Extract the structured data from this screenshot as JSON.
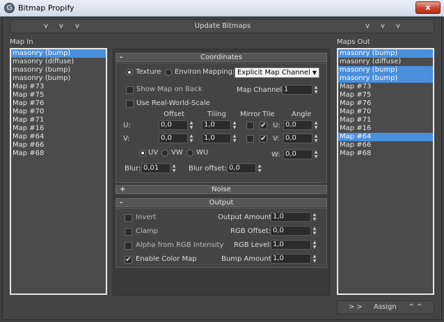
{
  "window": {
    "title": "Bitmap Propify",
    "close_glyph": "x",
    "app_icon": "G"
  },
  "topbar": {
    "chevrons": [
      "v",
      "v",
      "v",
      "v",
      "v",
      "v"
    ],
    "update_label": "Update Bitmaps"
  },
  "map_in": {
    "label": "Map In",
    "items": [
      {
        "text": "masonry (bump)",
        "selected": true
      },
      {
        "text": "masonry (diffuse)",
        "selected": false
      },
      {
        "text": "masonry (bump)",
        "selected": false
      },
      {
        "text": "masonry (bump)",
        "selected": false
      },
      {
        "text": "Map #73",
        "selected": false
      },
      {
        "text": "Map #75",
        "selected": false
      },
      {
        "text": "Map #76",
        "selected": false
      },
      {
        "text": "Map #70",
        "selected": false
      },
      {
        "text": "Map #71",
        "selected": false
      },
      {
        "text": "Map #16",
        "selected": false
      },
      {
        "text": "Map #64",
        "selected": false
      },
      {
        "text": "Map #66",
        "selected": false
      },
      {
        "text": "Map #68",
        "selected": false
      }
    ]
  },
  "map_out": {
    "label": "Maps Out",
    "items": [
      {
        "text": "masonry (bump)",
        "selected": true
      },
      {
        "text": "masonry (diffuse)",
        "selected": false
      },
      {
        "text": "masonry (bump)",
        "selected": true
      },
      {
        "text": "masonry (bump)",
        "selected": true
      },
      {
        "text": "Map #73",
        "selected": false
      },
      {
        "text": "Map #75",
        "selected": false
      },
      {
        "text": "Map #76",
        "selected": false
      },
      {
        "text": "Map #70",
        "selected": false
      },
      {
        "text": "Map #71",
        "selected": false
      },
      {
        "text": "Map #16",
        "selected": false
      },
      {
        "text": "Map #64",
        "selected": true
      },
      {
        "text": "Map #66",
        "selected": false
      },
      {
        "text": "Map #68",
        "selected": false
      }
    ]
  },
  "coordinates": {
    "header": "Coordinates",
    "toggle": "-",
    "texture_label": "Texture",
    "environ_label": "Environ",
    "mapping_label": "Mapping:",
    "mapping_value": "Explicit Map Channel",
    "show_map_on_back": "Show Map on Back",
    "map_channel_label": "Map Channel:",
    "map_channel_value": "1",
    "use_real_world": "Use Real-World-Scale",
    "col_offset": "Offset",
    "col_tiling": "Tiling",
    "col_mirror": "Mirror",
    "col_tile": "Tile",
    "col_angle": "Angle",
    "u_label": "U:",
    "v_label": "V:",
    "w_label": "W:",
    "u_offset": "0,0",
    "v_offset": "0,0",
    "u_tiling": "1,0",
    "v_tiling": "1,0",
    "u_tile_checked": "✔",
    "v_tile_checked": "✔",
    "u_angle": "0,0",
    "v_angle": "0,0",
    "w_angle": "0,0",
    "uv_label": "UV",
    "vw_label": "VW",
    "wu_label": "WU",
    "blur_label": "Blur:",
    "blur_value": "0,01",
    "blur_offset_label": "Blur offset:",
    "blur_offset_value": "0,0"
  },
  "noise": {
    "header": "Noise",
    "toggle": "+"
  },
  "output": {
    "header": "Output",
    "toggle": "-",
    "invert": "Invert",
    "clamp": "Clamp",
    "alpha_from_rgb": "Alpha from RGB Intensity",
    "enable_color_map": "Enable Color Map",
    "enable_color_map_check": "✔",
    "output_amount_label": "Output Amount:",
    "output_amount": "1,0",
    "rgb_offset_label": "RGB Offset:",
    "rgb_offset": "0,0",
    "rgb_level_label": "RGB Level:",
    "rgb_level": "1,0",
    "bump_amount_label": "Bump Amount:",
    "bump_amount": "1,0"
  },
  "bottombar": {
    "forward": "> >",
    "assign_label": "Assign",
    "up": "^ ^"
  },
  "colors": {
    "selection": "#4a8fdc",
    "background": "#444444"
  }
}
